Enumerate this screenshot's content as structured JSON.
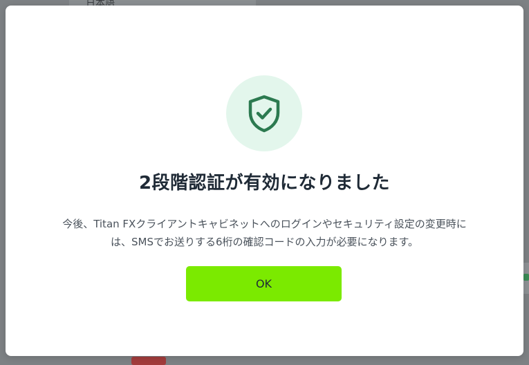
{
  "background": {
    "partial_text": "日本語"
  },
  "modal": {
    "icon": "shield-check-icon",
    "title": "2段階認証が有効になりました",
    "description_line1": "今後、Titan FXクライアントキャビネットへのログインやセキュリティ設定の変更時に",
    "description_line2": "は、SMSでお送りする6桁の確認コードの入力が必要になります。",
    "ok_label": "OK"
  },
  "colors": {
    "accent_button": "#7bea00",
    "icon_stroke": "#2c7a50",
    "icon_bg": "#e3f6ec",
    "title_text": "#1f2a36",
    "overlay": "#7d8184"
  }
}
